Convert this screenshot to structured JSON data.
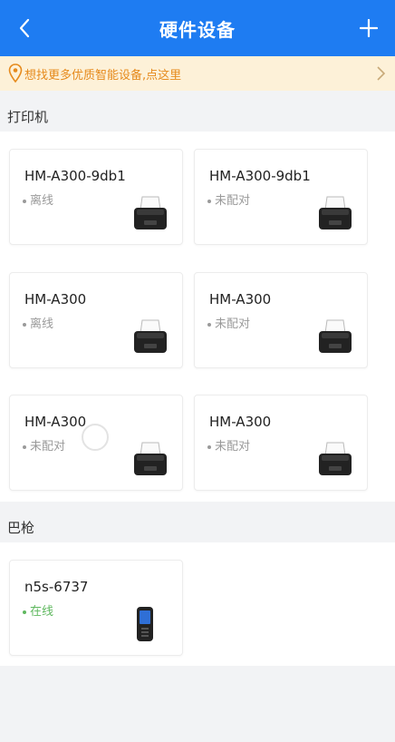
{
  "header": {
    "title": "硬件设备",
    "back_icon": "chevron-left-icon",
    "add_icon": "plus-icon"
  },
  "banner": {
    "text": "想找更多优质智能设备,点这里",
    "icon": "location-pin-icon",
    "color": "#e68a1c"
  },
  "sections": [
    {
      "label": "打印机",
      "devices": [
        {
          "name": "HM-A300-9db1",
          "status": "离线",
          "icon": "receipt-printer-icon"
        },
        {
          "name": "HM-A300-9db1",
          "status": "未配对",
          "icon": "receipt-printer-icon"
        },
        {
          "name": "HM-A300",
          "status": "离线",
          "icon": "receipt-printer-icon"
        },
        {
          "name": "HM-A300",
          "status": "未配对",
          "icon": "receipt-printer-icon"
        },
        {
          "name": "HM-A300",
          "status": "未配对",
          "icon": "receipt-printer-icon"
        },
        {
          "name": "HM-A300",
          "status": "未配对",
          "icon": "receipt-printer-icon"
        }
      ]
    },
    {
      "label": "巴枪",
      "devices": [
        {
          "name": "n5s-6737",
          "status": "在线",
          "icon": "handheld-scanner-icon"
        }
      ]
    }
  ],
  "colors": {
    "header": "#1e7cf2",
    "online": "#5fb85f",
    "offline": "#9a9a9a"
  }
}
